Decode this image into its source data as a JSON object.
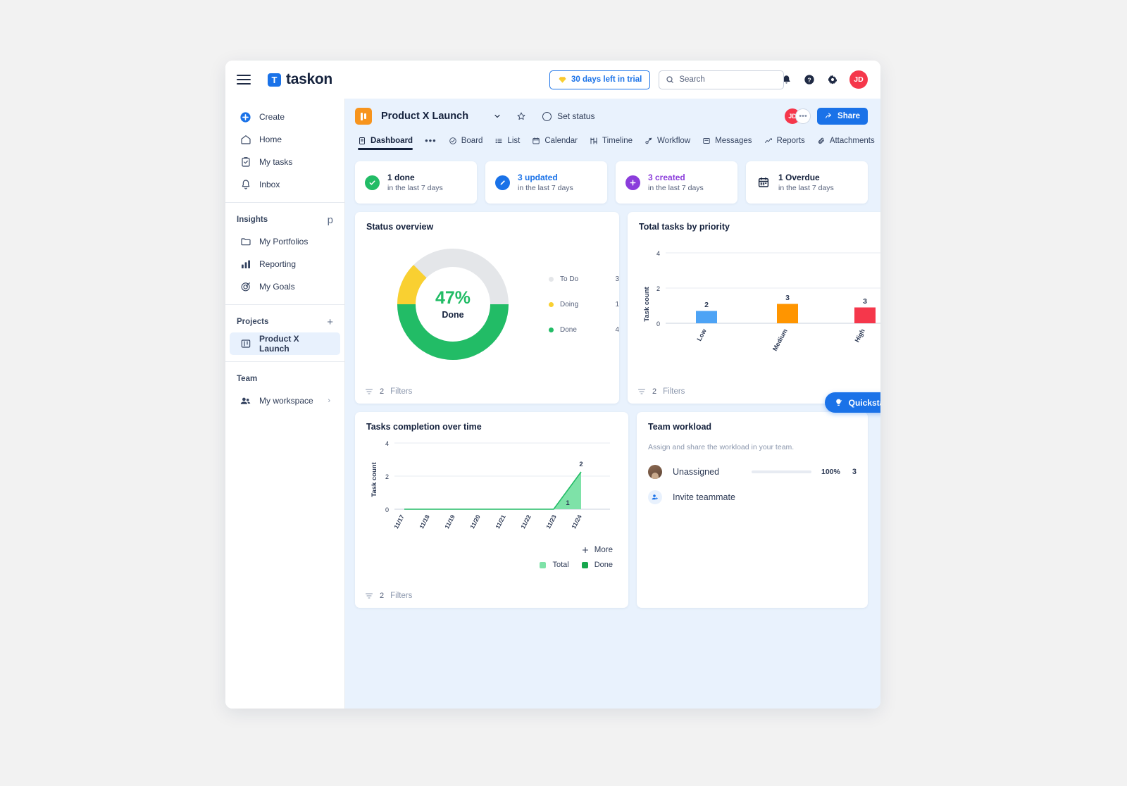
{
  "topbar": {
    "menu_icon": "hamburger-icon",
    "brand_initial": "T",
    "brand_name": "taskon",
    "trial_label": "30 days left in trial",
    "trial_icon": "diamond-icon",
    "search_placeholder": "Search",
    "search_value": "",
    "search_icon": "search-icon",
    "notifications_icon": "bell-icon",
    "help_icon": "question-circle-icon",
    "settings_icon": "gear-icon",
    "avatar_initials": "JD",
    "avatar_color": "#f5374b"
  },
  "sidebar": {
    "primary": [
      {
        "label": "Create",
        "icon": "plus-circle-icon"
      },
      {
        "label": "Home",
        "icon": "home-icon"
      },
      {
        "label": "My tasks",
        "icon": "clipboard-check-icon"
      },
      {
        "label": "Inbox",
        "icon": "bell-icon"
      }
    ],
    "insights": {
      "title": "Insights",
      "add_icon": "plus-icon",
      "items": [
        {
          "label": "My Portfolios",
          "icon": "folder-icon"
        },
        {
          "label": "Reporting",
          "icon": "bar-chart-icon"
        },
        {
          "label": "My Goals",
          "icon": "target-icon"
        }
      ]
    },
    "projects": {
      "title": "Projects",
      "add_icon": "plus-icon",
      "items": [
        {
          "label": "Product X Launch",
          "icon": "project-board-icon"
        }
      ]
    },
    "team": {
      "title": "Team",
      "items": [
        {
          "label": "My workspace",
          "icon": "people-icon",
          "chevron": "chevron-right-icon"
        }
      ]
    }
  },
  "project": {
    "icon": "project-board-icon",
    "name": "Product X Launch",
    "dropdown_icon": "chevron-down-icon",
    "star_icon": "star-icon",
    "status_icon": "circle-icon",
    "status_label": "Set status",
    "member_initials": "JD",
    "member_more": "•••",
    "share_label": "Share",
    "share_icon": "share-arrow-icon"
  },
  "tabs": [
    {
      "label": "Dashboard",
      "icon": "dashboard-icon",
      "active": true
    },
    {
      "label": "Board",
      "icon": "board-icon",
      "active": false
    },
    {
      "label": "List",
      "icon": "list-icon",
      "active": false
    },
    {
      "label": "Calendar",
      "icon": "calendar-icon",
      "active": false
    },
    {
      "label": "Timeline",
      "icon": "timeline-icon",
      "active": false
    },
    {
      "label": "Workflow",
      "icon": "workflow-icon",
      "active": false
    },
    {
      "label": "Messages",
      "icon": "message-icon",
      "active": false
    },
    {
      "label": "Reports",
      "icon": "reports-icon",
      "active": false
    },
    {
      "label": "Attachments",
      "icon": "paperclip-icon",
      "active": false
    }
  ],
  "tab_overflow": "•••",
  "tab_add": "+",
  "stats": [
    {
      "title": "1 done",
      "sub": "in the last 7 days",
      "icon": "check-circle-icon",
      "color": "#22bc66"
    },
    {
      "title": "3 updated",
      "sub": "in the last 7 days",
      "icon": "pencil-circle-icon",
      "color": "#1a72e8"
    },
    {
      "title": "3 created",
      "sub": "in the last 7 days",
      "icon": "plus-circle-icon",
      "color": "#8b3ddb"
    },
    {
      "title": "1 Overdue",
      "sub": "in the last 7 days",
      "icon": "calendar-icon",
      "color": "#15223d"
    }
  ],
  "filters_label": "Filters",
  "filters_count": "2",
  "filters_icon": "filter-icon",
  "panels": {
    "status_overview": {
      "title": "Status overview"
    },
    "priority": {
      "title": "Total tasks by priority"
    },
    "completion": {
      "title": "Tasks completion over time"
    },
    "workload": {
      "title": "Team workload",
      "subtitle": "Assign and share the workload in your team.",
      "rows": [
        {
          "name": "Unassigned",
          "percent": "100%",
          "count": "3",
          "fill": 100
        }
      ],
      "invite_label": "Invite teammate",
      "invite_icon": "person-add-icon"
    }
  },
  "line_chart_controls": {
    "more_label": "More",
    "more_icon": "plus-icon",
    "legend": [
      {
        "label": "Total",
        "color": "#7ee2a8"
      },
      {
        "label": "Done",
        "color": "#17a74d"
      }
    ]
  },
  "quickstart": {
    "label": "Quickstart",
    "icon": "lightbulb-icon",
    "close_icon": "close-circle-icon"
  },
  "chart_data": [
    {
      "type": "pie",
      "title": "Status overview",
      "center_value": "47%",
      "center_label": "Done",
      "categories": [
        "To Do",
        "Doing",
        "Done"
      ],
      "values": [
        3,
        1,
        4
      ],
      "colors": [
        "#e4e6e9",
        "#f9d031",
        "#22bc66"
      ],
      "total": 8,
      "legend": "right",
      "donut": true
    },
    {
      "type": "bar",
      "title": "Total tasks by priority",
      "categories": [
        "Low",
        "Medium",
        "High"
      ],
      "values": [
        2,
        3,
        3
      ],
      "bar_heights": [
        0.7,
        1.1,
        0.9
      ],
      "colors": [
        "#4da3f5",
        "#ff9500",
        "#f5374b"
      ],
      "xlabel": "",
      "ylabel": "Task count",
      "ylim": [
        0,
        4
      ],
      "yticks": [
        0,
        2,
        4
      ],
      "grid": true
    },
    {
      "type": "area",
      "title": "Tasks completion over time",
      "x": [
        "11/17",
        "11/18",
        "11/19",
        "11/20",
        "11/21",
        "11/22",
        "11/23",
        "11/24"
      ],
      "series": [
        {
          "name": "Total",
          "values": [
            0,
            0,
            0,
            0,
            0,
            0,
            0,
            2
          ],
          "color": "#7ee2a8"
        },
        {
          "name": "Done",
          "values": [
            0,
            0,
            0,
            0,
            0,
            0,
            0,
            0
          ],
          "color": "#17a74d"
        }
      ],
      "point_labels": [
        {
          "x": "11/24",
          "value": "2"
        },
        {
          "x": "11/23",
          "value": "1"
        }
      ],
      "xlabel": "",
      "ylabel": "Task count",
      "ylim": [
        0,
        4
      ],
      "yticks": [
        0,
        2,
        4
      ],
      "grid": true,
      "legend": "bottom"
    }
  ]
}
